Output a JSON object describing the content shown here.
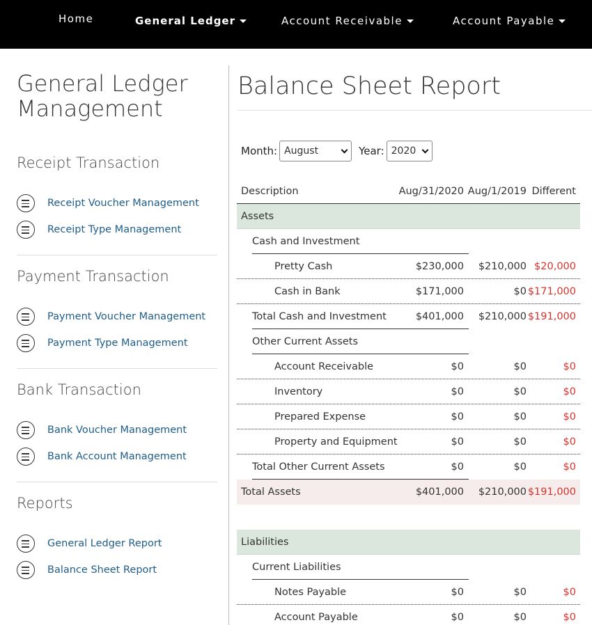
{
  "nav": {
    "home": "Home",
    "general_ledger": "General Ledger",
    "account_receivable": "Account Receivable",
    "account_payable": "Account Payable"
  },
  "sidebar": {
    "title_line1": "General Ledger",
    "title_line2": "Management",
    "sections": [
      {
        "title": "Receipt Transaction",
        "links": [
          "Receipt Voucher Management",
          "Receipt Type Management"
        ]
      },
      {
        "title": "Payment Transaction",
        "links": [
          "Payment Voucher Management",
          "Payment Type Management"
        ]
      },
      {
        "title": "Bank Transaction",
        "links": [
          "Bank Voucher Management",
          "Bank Account Management"
        ]
      },
      {
        "title": "Reports",
        "links": [
          "General Ledger Report",
          "Balance Sheet Report"
        ]
      }
    ]
  },
  "main": {
    "title": "Balance Sheet Report",
    "filters": {
      "month_label": "Month:",
      "month_value": "August",
      "year_label": "Year:",
      "year_value": "2020"
    },
    "table": {
      "headers": [
        "Description",
        "Aug/31/2020",
        "Aug/1/2019",
        "Different"
      ],
      "rows": [
        {
          "type": "group",
          "desc": "Assets"
        },
        {
          "type": "sub",
          "desc": "Cash and Investment"
        },
        {
          "type": "item",
          "desc": "Pretty Cash",
          "v1": "$230,000",
          "v2": "$210,000",
          "v3": "$20,000"
        },
        {
          "type": "item",
          "desc": "Cash in Bank",
          "v1": "$171,000",
          "v2": "$0",
          "v3": "$171,000"
        },
        {
          "type": "subtotal",
          "desc": "Total Cash and Investment",
          "v1": "$401,000",
          "v2": "$210,000",
          "v3": "$191,000"
        },
        {
          "type": "sub",
          "desc": "Other Current Assets"
        },
        {
          "type": "item",
          "desc": "Account Receivable",
          "v1": "$0",
          "v2": "$0",
          "v3": "$0"
        },
        {
          "type": "item",
          "desc": "Inventory",
          "v1": "$0",
          "v2": "$0",
          "v3": "$0"
        },
        {
          "type": "item",
          "desc": "Prepared Expense",
          "v1": "$0",
          "v2": "$0",
          "v3": "$0"
        },
        {
          "type": "item",
          "desc": "Property and Equipment",
          "v1": "$0",
          "v2": "$0",
          "v3": "$0"
        },
        {
          "type": "subtotal",
          "desc": "Total Other Current Assets",
          "v1": "$0",
          "v2": "$0",
          "v3": "$0"
        },
        {
          "type": "total",
          "desc": "Total Assets",
          "v1": "$401,000",
          "v2": "$210,000",
          "v3": "$191,000"
        },
        {
          "type": "spacer"
        },
        {
          "type": "group",
          "desc": "Liabilities"
        },
        {
          "type": "sub",
          "desc": "Current Liabilities"
        },
        {
          "type": "item",
          "desc": "Notes Payable",
          "v1": "$0",
          "v2": "$0",
          "v3": "$0"
        },
        {
          "type": "item",
          "desc": "Account Payable",
          "v1": "$0",
          "v2": "$0",
          "v3": "$0"
        }
      ]
    }
  },
  "colors": {
    "nav_bg": "#000000",
    "link": "#1f5d8a",
    "group_bg": "#dbe6dd",
    "total_bg": "#f6eceb",
    "diff_text": "#d9322c"
  }
}
